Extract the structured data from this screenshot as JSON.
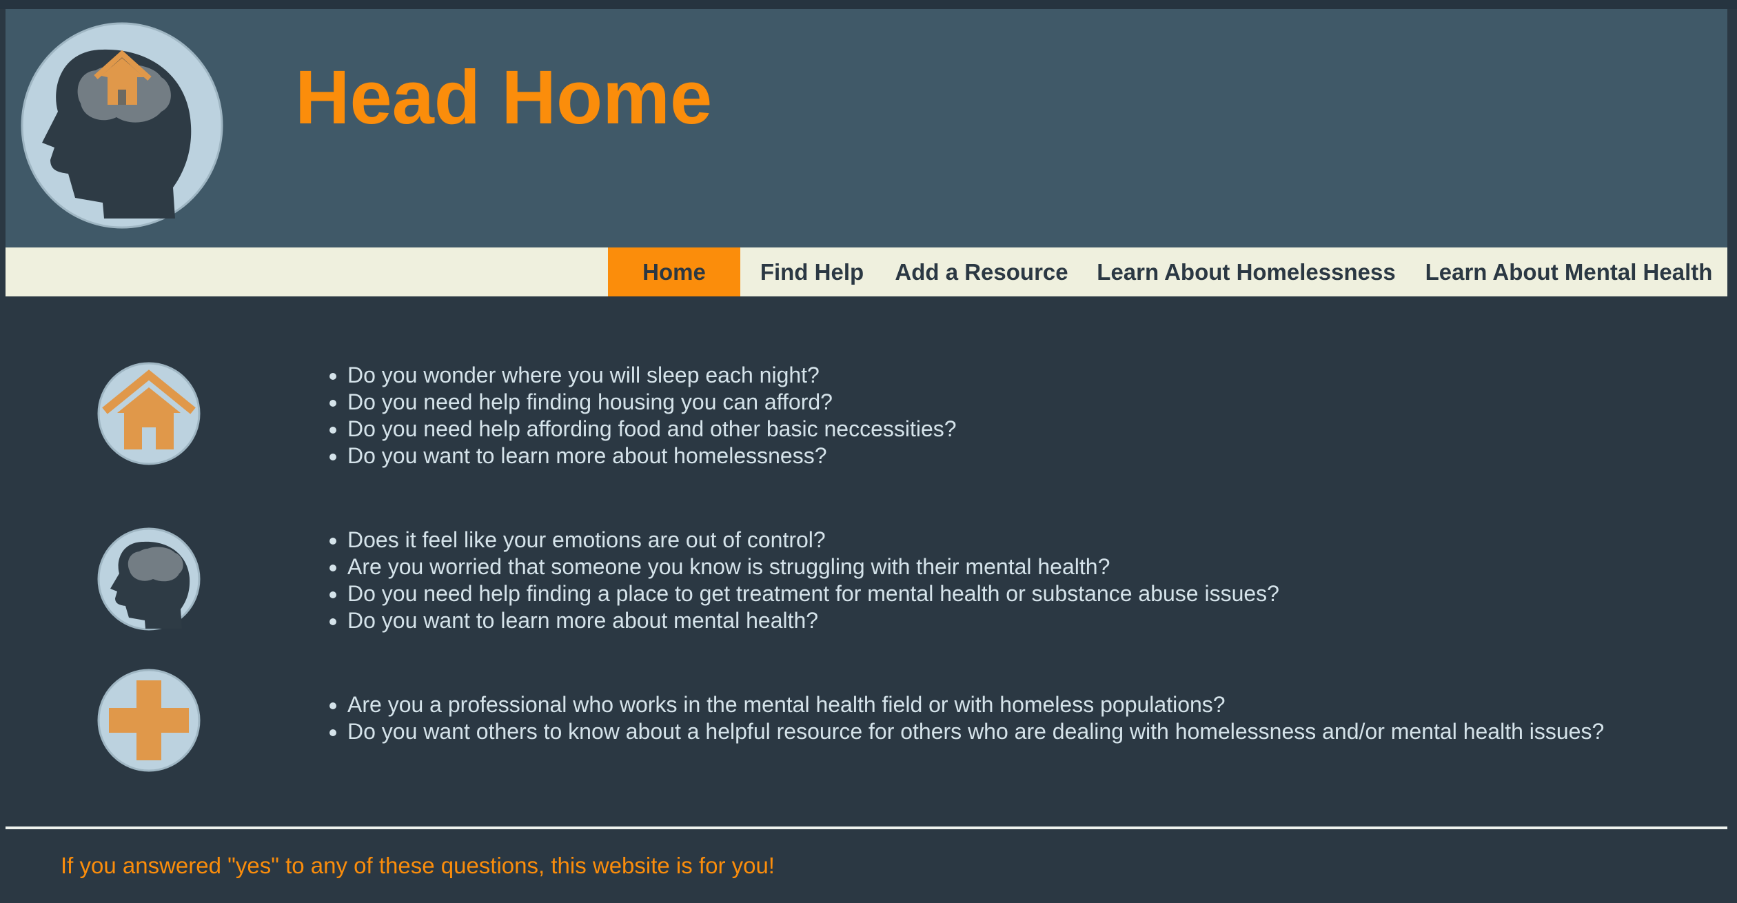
{
  "header": {
    "title": "Head Home",
    "logo_icon": "head-with-house-icon"
  },
  "nav": {
    "items": [
      {
        "label": "Home",
        "active": true
      },
      {
        "label": "Find Help",
        "active": false
      },
      {
        "label": "Add a Resource",
        "active": false
      },
      {
        "label": "Learn About Homelessness",
        "active": false
      },
      {
        "label": "Learn About Mental Health",
        "active": false
      }
    ]
  },
  "sections": [
    {
      "icon": "house-icon",
      "questions": [
        "Do you wonder where you will sleep each night?",
        "Do you need help finding housing you can afford?",
        "Do you need help affording food and other basic neccessities?",
        "Do you want to learn more about homelessness?"
      ]
    },
    {
      "icon": "head-brain-icon",
      "questions": [
        "Does it feel like your emotions are out of control?",
        "Are you worried that someone you know is struggling with their mental health?",
        "Do you need help finding a place to get treatment for mental health or substance abuse issues?",
        "Do you want to learn more about mental health?"
      ]
    },
    {
      "icon": "medical-cross-icon",
      "questions": [
        "Are you a professional who works in the mental health field or with homeless populations?",
        "Do you want others to know about a helpful resource for others who are dealing with homelessness and/or mental health issues?"
      ]
    }
  ],
  "footer": {
    "note": "If you answered \"yes\" to any of these questions, this website is for you!"
  },
  "colors": {
    "background": "#2b3843",
    "header": "#405968",
    "accent": "#fb8d0b",
    "nav_bg": "#eff0de",
    "text": "#d5e3ea",
    "icon_circle": "#bcd2df"
  }
}
